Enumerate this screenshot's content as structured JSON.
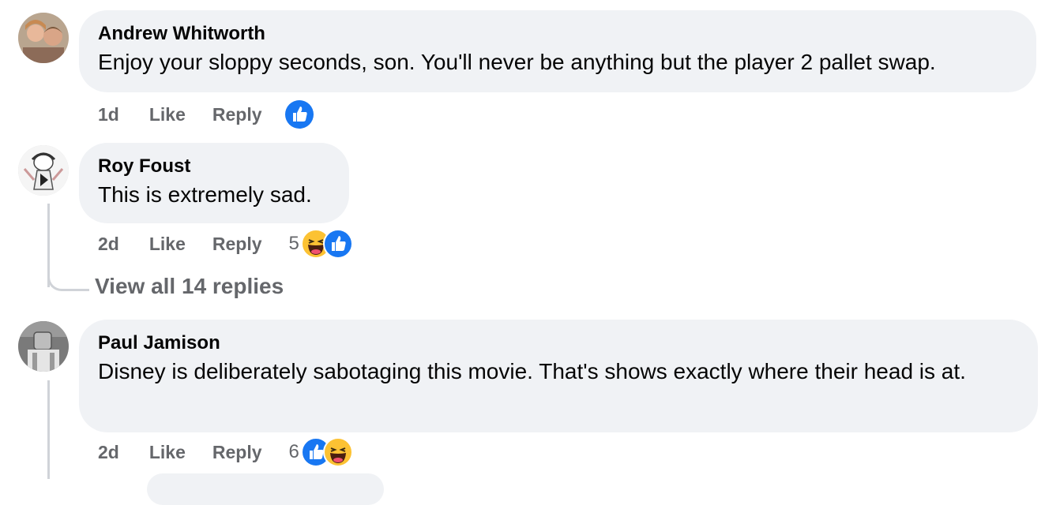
{
  "comments": [
    {
      "author": "Andrew Whitworth",
      "text": "Enjoy your sloppy seconds, son. You'll never be anything but the player 2 pallet swap.",
      "time": "1d",
      "like_label": "Like",
      "reply_label": "Reply",
      "reaction_count": "",
      "reactions": [
        "like-icon"
      ]
    },
    {
      "author": "Roy Foust",
      "text": "This is extremely sad.",
      "time": "2d",
      "like_label": "Like",
      "reply_label": "Reply",
      "reaction_count": "5",
      "reactions": [
        "haha-icon",
        "like-icon"
      ]
    },
    {
      "author": "Paul Jamison",
      "text": "Disney is deliberately sabotaging this movie. That's shows exactly where their head is at.",
      "time": "2d",
      "like_label": "Like",
      "reply_label": "Reply",
      "reaction_count": "6",
      "reactions": [
        "like-icon",
        "haha-icon"
      ]
    }
  ],
  "view_replies_label": "View all 14 replies",
  "colors": {
    "bubble": "#f0f2f5",
    "muted_text": "#65676b",
    "like_blue": "#1877f2",
    "haha_yellow": "#fcc233"
  }
}
